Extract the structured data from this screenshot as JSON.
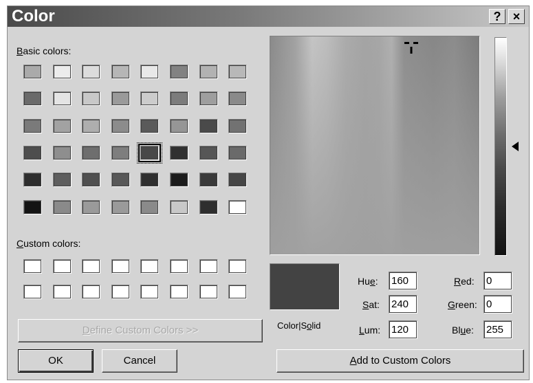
{
  "dialog": {
    "title": "Color",
    "help_label": "?",
    "close_label": "×"
  },
  "basic_colors": {
    "label_first": "B",
    "label_rest": "asic colors:",
    "rows": [
      [
        "#aaaaaa",
        "#ececec",
        "#dcdcdc",
        "#b6b6b6",
        "#e8e8e8",
        "#828282",
        "#b2b2b2",
        "#b8b8b8"
      ],
      [
        "#6a6a6a",
        "#e4e4e4",
        "#c8c8c8",
        "#9a9a9a",
        "#cccccc",
        "#7c7c7c",
        "#9e9e9e",
        "#8a8a8a"
      ],
      [
        "#7a7a7a",
        "#a2a2a2",
        "#aeaeae",
        "#8c8c8c",
        "#5a5a5a",
        "#969696",
        "#4a4a4a",
        "#727272"
      ],
      [
        "#4e4e4e",
        "#8e8e8e",
        "#6e6e6e",
        "#7e7e7e",
        "#484848",
        "#303030",
        "#565656",
        "#6a6a6a"
      ],
      [
        "#2e2e2e",
        "#5e5e5e",
        "#505050",
        "#585858",
        "#303030",
        "#1c1c1c",
        "#3a3a3a",
        "#464646"
      ],
      [
        "#141414",
        "#8a8a8a",
        "#9a9a9a",
        "#9a9a9a",
        "#8a8a8a",
        "#c8c8c8",
        "#2e2e2e",
        "#ffffff"
      ]
    ],
    "selected": {
      "row": 3,
      "col": 4
    }
  },
  "custom_colors": {
    "label_first": "C",
    "label_rest": "ustom colors:",
    "rows": [
      [
        "#ffffff",
        "#ffffff",
        "#ffffff",
        "#ffffff",
        "#ffffff",
        "#ffffff",
        "#ffffff",
        "#ffffff"
      ],
      [
        "#ffffff",
        "#ffffff",
        "#ffffff",
        "#ffffff",
        "#ffffff",
        "#ffffff",
        "#ffffff",
        "#ffffff"
      ]
    ]
  },
  "buttons": {
    "define_first": "D",
    "define_rest": "efine Custom Colors >>",
    "ok": "OK",
    "cancel": "Cancel",
    "add_first": "A",
    "add_rest": "dd to Custom Colors"
  },
  "preview": {
    "color": "#434343",
    "label_a": "Color|S",
    "label_u": "o",
    "label_b": "lid"
  },
  "fields": {
    "hue": {
      "pre": "Hu",
      "u": "e",
      "post": ":",
      "value": "160"
    },
    "sat": {
      "pre": "",
      "u": "S",
      "post": "at:",
      "value": "240"
    },
    "lum": {
      "pre": "",
      "u": "L",
      "post": "um:",
      "value": "120"
    },
    "red": {
      "pre": "",
      "u": "R",
      "post": "ed:",
      "value": "0"
    },
    "green": {
      "pre": "",
      "u": "G",
      "post": "reen:",
      "value": "0"
    },
    "blue": {
      "pre": "Bl",
      "u": "u",
      "post": "e:",
      "value": "255"
    }
  },
  "luminance_level": 0.5,
  "accent_colors": {
    "titlebar_start": "#4a4a4a",
    "face": "#d4d4d4"
  }
}
